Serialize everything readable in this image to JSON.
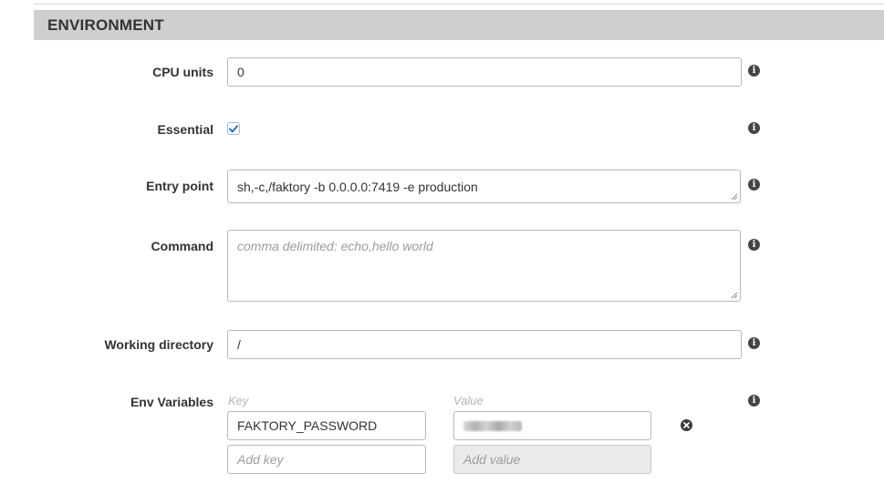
{
  "section": {
    "title": "ENVIRONMENT"
  },
  "fields": {
    "cpu_units": {
      "label": "CPU units",
      "value": "0"
    },
    "essential": {
      "label": "Essential",
      "checked": true
    },
    "entry_point": {
      "label": "Entry point",
      "value": "sh,-c,/faktory -b 0.0.0.0:7419 -e production"
    },
    "command": {
      "label": "Command",
      "value": "",
      "placeholder": "comma delimited: echo,hello world"
    },
    "working_directory": {
      "label": "Working directory",
      "value": "/"
    },
    "env_variables": {
      "label": "Env Variables",
      "key_header": "Key",
      "value_header": "Value",
      "rows": [
        {
          "key": "FAKTORY_PASSWORD",
          "value_masked": true
        }
      ],
      "new_key_placeholder": "Add key",
      "new_value_placeholder": "Add value"
    }
  },
  "icons": {
    "info": "info-icon",
    "remove": "remove-circle-icon",
    "check": "checkmark-icon"
  },
  "colors": {
    "header_bg": "#cfcfcf",
    "checkbox_check": "#2a6ebb",
    "icon_dark": "#454545"
  }
}
